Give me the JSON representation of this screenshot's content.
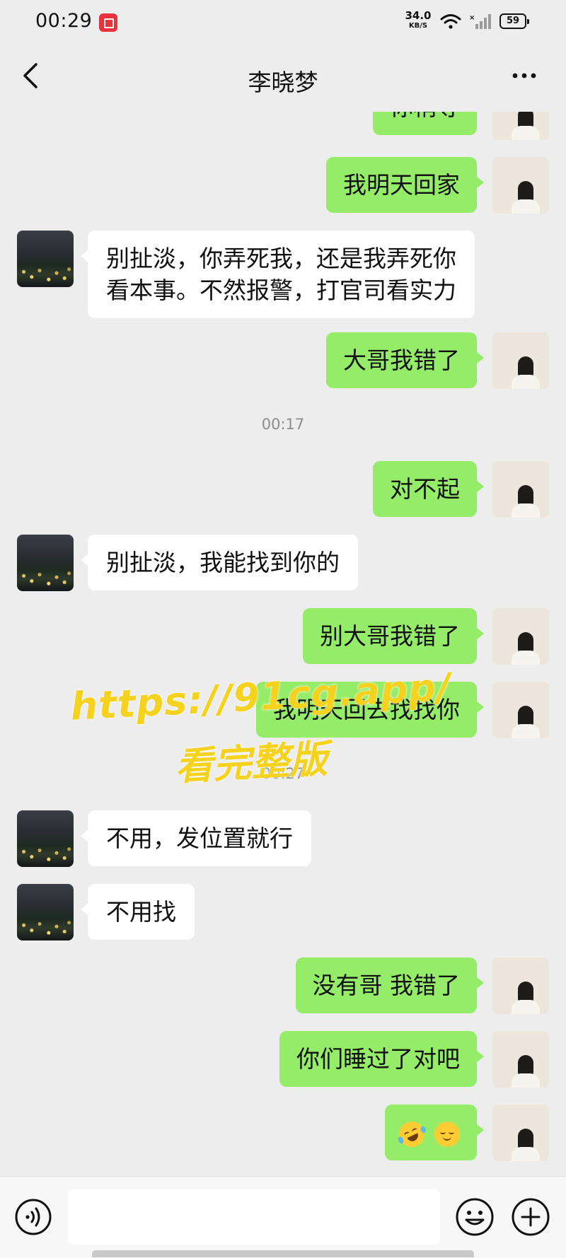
{
  "status_bar": {
    "time": "00:29",
    "net_speed_value": "34.0",
    "net_speed_unit": "KB/S",
    "battery": "59",
    "icons": [
      "screen-record-icon",
      "wifi-icon",
      "signal-icon",
      "battery-icon"
    ]
  },
  "header": {
    "title": "李晓梦",
    "back_icon": "chevron-left-icon",
    "more_icon": "more-dots-icon"
  },
  "messages": [
    {
      "side": "out",
      "text": "你稍等"
    },
    {
      "side": "out",
      "text": "我明天回家"
    },
    {
      "side": "in",
      "text_line1": "别扯淡，你弄死我，还是我弄死你",
      "text_line2": "看本事。不然报警，打官司看实力"
    },
    {
      "side": "out",
      "text": "大哥我错了"
    },
    {
      "type": "time",
      "text": "00:17"
    },
    {
      "side": "out",
      "text": "对不起"
    },
    {
      "side": "in",
      "text": "别扯淡，我能找到你的"
    },
    {
      "side": "out",
      "text": "别大哥我错了"
    },
    {
      "side": "out",
      "text": "我明天回去找找你"
    },
    {
      "type": "time",
      "text": "00:27"
    },
    {
      "side": "in",
      "text": "不用，发位置就行"
    },
    {
      "side": "in",
      "text": "不用找"
    },
    {
      "side": "out",
      "text": "没有哥 我错了"
    },
    {
      "side": "out",
      "text": "你们睡过了对吧"
    },
    {
      "side": "out",
      "emojis": [
        "rolling-laughing-emoji",
        "relieved-emoji"
      ]
    }
  ],
  "watermark": {
    "url": "https://91cg.app/",
    "caption": "看完整版",
    "color": "#f5d21e"
  },
  "input_bar": {
    "placeholder": "",
    "value": "",
    "icons": [
      "voice-icon",
      "emoji-icon",
      "plus-icon"
    ]
  },
  "colors": {
    "background": "#ededed",
    "outgoing_bubble": "#95ec69",
    "incoming_bubble": "#ffffff"
  }
}
